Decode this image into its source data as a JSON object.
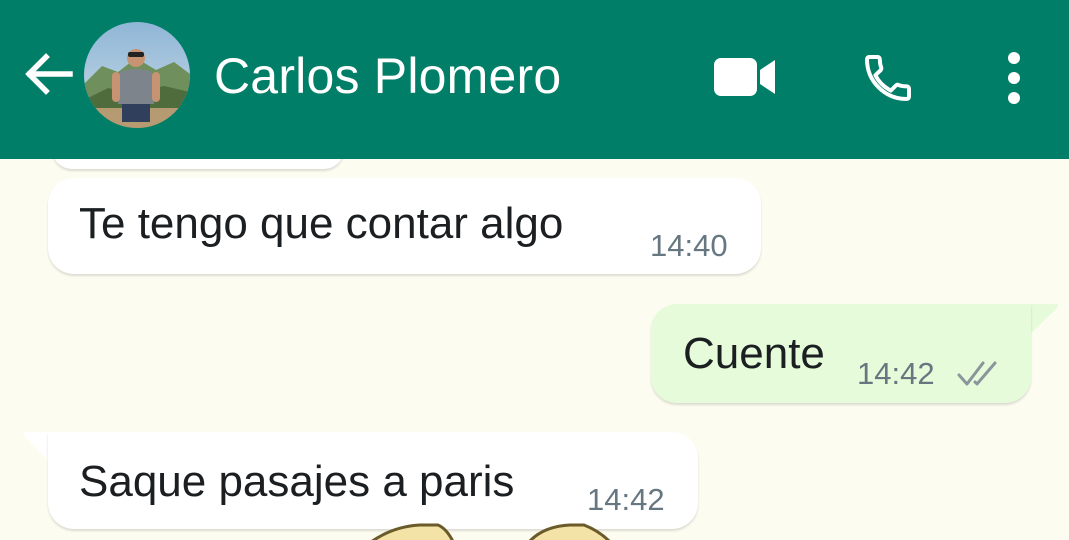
{
  "header": {
    "contact_name": "Carlos Plomero",
    "back_icon": "arrow-left-icon",
    "video_icon": "video-camera-icon",
    "call_icon": "phone-icon",
    "menu_icon": "more-vertical-icon",
    "background_color": "#007e67"
  },
  "messages": [
    {
      "direction": "incoming",
      "text": "Te tengo que contar algo",
      "time": "14:40"
    },
    {
      "direction": "outgoing",
      "text": "Cuente",
      "time": "14:42",
      "status": "delivered-double-check"
    },
    {
      "direction": "incoming",
      "text": "Saque pasajes a paris",
      "time": "14:42"
    }
  ],
  "colors": {
    "incoming_bubble": "#ffffff",
    "outgoing_bubble": "#e5fbd9",
    "chat_background": "#fcfcf1",
    "timestamp": "#667781"
  }
}
